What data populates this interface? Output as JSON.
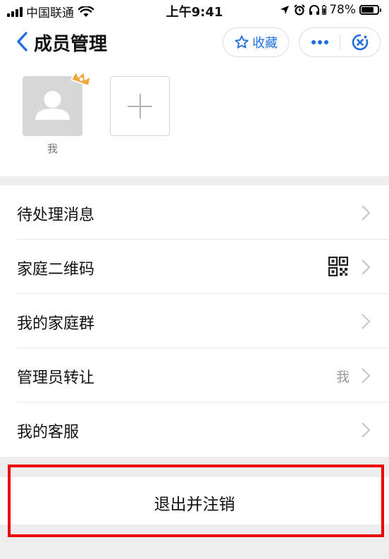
{
  "status_bar": {
    "carrier": "中国联通",
    "time": "上午9:41",
    "battery": "78%",
    "battery_level": 0.78
  },
  "nav": {
    "title": "成员管理",
    "favorite_label": "收藏"
  },
  "members": [
    {
      "name": "我",
      "is_admin": true
    }
  ],
  "menu": [
    {
      "label": "待处理消息",
      "value": ""
    },
    {
      "label": "家庭二维码",
      "value": ""
    },
    {
      "label": "我的家庭群",
      "value": ""
    },
    {
      "label": "管理员转让",
      "value": "我"
    },
    {
      "label": "我的客服",
      "value": ""
    }
  ],
  "logout_label": "退出并注销",
  "colors": {
    "accent": "#1f6fe0",
    "highlight": "#ee0000",
    "crown": "#f0a73a",
    "background": "#ededed"
  },
  "icons": [
    "wifi-icon",
    "location-icon",
    "alarm-icon",
    "headphones-icon",
    "star-icon",
    "more-icon",
    "close-icon",
    "crown-icon",
    "plus-icon",
    "qr-code-icon",
    "chevron-right-icon"
  ]
}
